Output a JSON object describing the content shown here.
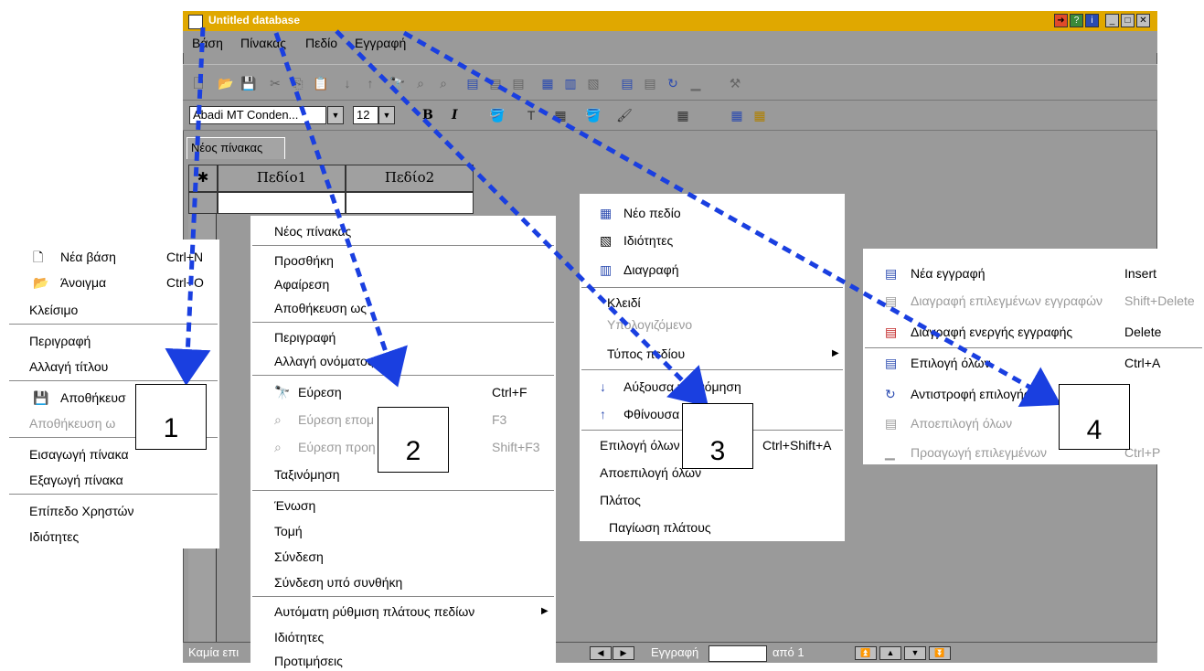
{
  "window": {
    "title": "Untitled database",
    "menubar": [
      "Βάση",
      "Πίνακας",
      "Πεδίο",
      "Εγγραφή"
    ],
    "font_name": "Abadi MT Conden...",
    "font_size": "12",
    "bold_label": "B",
    "italic_label": "I",
    "tab_label": "Νέος πίνακας",
    "grid_headers": [
      "Πεδίο1",
      "Πεδίο2"
    ],
    "status": {
      "left_text": "Καμία επι",
      "record_label": "Εγγραφή",
      "of_label": "από 1"
    }
  },
  "menu1": {
    "items": [
      {
        "label": "Νέα βάση",
        "shortcut": "Ctrl+N",
        "icon": "new-file-icon"
      },
      {
        "label": "Άνοιγμα",
        "shortcut": "Ctrl+O",
        "icon": "open-folder-icon"
      },
      {
        "label": "Κλείσιμο"
      },
      {
        "label": "Περιγραφή"
      },
      {
        "label": "Αλλαγή τίτλου"
      },
      {
        "label": "Αποθήκευσ",
        "icon": "save-disk-icon"
      },
      {
        "label": "Αποθήκευση ω",
        "disabled": true
      },
      {
        "label": "Εισαγωγή πίνακα"
      },
      {
        "label": "Εξαγωγή πίνακα"
      },
      {
        "label": "Επίπεδο Χρηστών"
      },
      {
        "label": "Ιδιότητες"
      }
    ]
  },
  "menu2": {
    "items": [
      {
        "label": "Νέος πίνακας"
      },
      {
        "label": "Προσθήκη"
      },
      {
        "label": "Αφαίρεση"
      },
      {
        "label": "Αποθήκευση ως"
      },
      {
        "label": "Περιγραφή"
      },
      {
        "label": "Αλλαγή ονόματος"
      },
      {
        "label": "Εύρεση",
        "shortcut": "Ctrl+F",
        "icon": "binoculars-icon"
      },
      {
        "label": "Εύρεση επομ",
        "shortcut": "F3",
        "disabled": true,
        "icon": "find-next-icon"
      },
      {
        "label": "Εύρεση προη",
        "shortcut": "Shift+F3",
        "disabled": true,
        "icon": "find-prev-icon"
      },
      {
        "label": "Ταξινόμηση"
      },
      {
        "label": "Ένωση"
      },
      {
        "label": "Τομή"
      },
      {
        "label": "Σύνδεση"
      },
      {
        "label": "Σύνδεση υπό συνθήκη"
      },
      {
        "label": "Αυτόματη ρύθμιση πλάτους πεδίων",
        "submenu": true
      },
      {
        "label": "Ιδιότητες"
      },
      {
        "label": "Προτιμήσεις"
      }
    ]
  },
  "menu3": {
    "items": [
      {
        "label": "Νέο πεδίο",
        "icon": "new-field-icon"
      },
      {
        "label": "Ιδιότητες",
        "icon": "properties-icon"
      },
      {
        "label": "Διαγραφή",
        "icon": "delete-field-icon"
      },
      {
        "label": "Κλειδί"
      },
      {
        "label": "Υπολογιζόμενο",
        "disabled": true
      },
      {
        "label": "Τύπος πεδίου",
        "submenu": true
      },
      {
        "label": "Αύξουσα ταξινόμηση",
        "icon": "sort-ascending-icon"
      },
      {
        "label": "Φθίνουσα τ",
        "icon": "sort-descending-icon"
      },
      {
        "label": "Επιλογή όλων",
        "shortcut": "Ctrl+Shift+A"
      },
      {
        "label": "Αποεπιλογή όλων"
      },
      {
        "label": "Πλάτος"
      },
      {
        "label": "Παγίωση πλάτους"
      }
    ]
  },
  "menu4": {
    "items": [
      {
        "label": "Νέα εγγραφή",
        "shortcut": "Insert",
        "icon": "new-record-icon"
      },
      {
        "label": "Διαγραφή επιλεγμένων εγγραφών",
        "shortcut": "Shift+Delete",
        "disabled": true,
        "icon": "delete-selected-icon"
      },
      {
        "label": "Διαγραφή ενεργής εγγραφής",
        "shortcut": "Delete",
        "icon": "delete-record-icon"
      },
      {
        "label": "Επιλογή όλων",
        "shortcut": "Ctrl+A",
        "icon": "select-all-icon"
      },
      {
        "label": "Αντιστροφή επιλογής",
        "icon": "invert-selection-icon"
      },
      {
        "label": "Αποεπιλογή όλων",
        "disabled": true,
        "icon": "deselect-icon"
      },
      {
        "label": "Προαγωγή επιλεγμένων",
        "shortcut": "Ctrl+P",
        "disabled": true,
        "icon": "promote-icon"
      }
    ]
  },
  "callouts": [
    "1",
    "2",
    "3",
    "4"
  ],
  "colors": {
    "titlebar": "#e0a800",
    "chrome": "#9a9a9a",
    "arrow": "#1a3fe0",
    "menu_bg": "#ffffff",
    "disabled_text": "#9a9a9a"
  }
}
